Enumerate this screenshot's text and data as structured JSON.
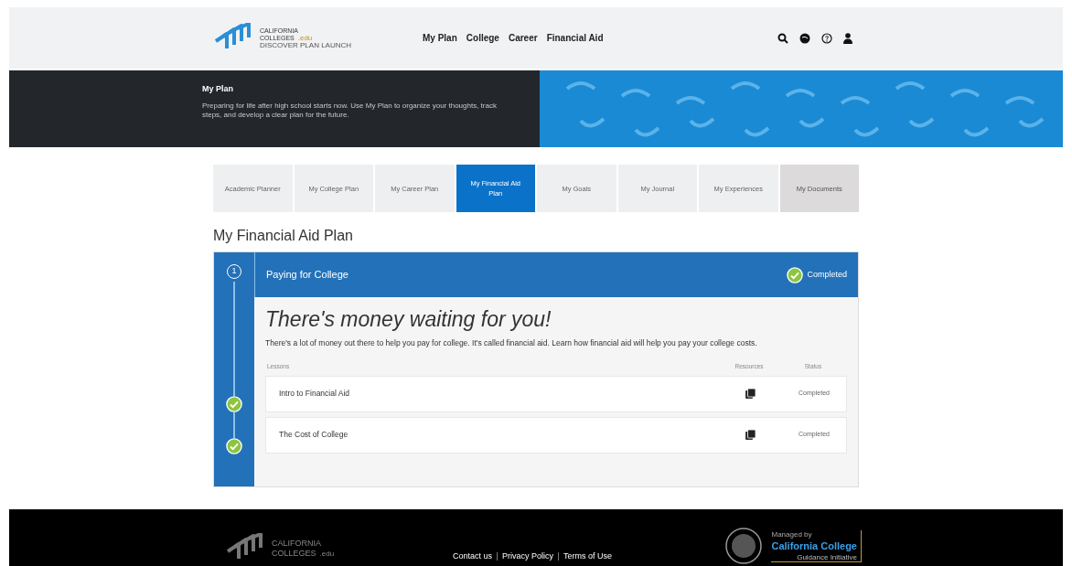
{
  "header": {
    "logo": {
      "line1": "CALIFORNIA",
      "line2": "COLLEGES",
      "suffix": ".edu",
      "tagline": "DISCOVER PLAN LAUNCH"
    },
    "nav": [
      "My Plan",
      "College",
      "Career",
      "Financial Aid"
    ]
  },
  "hero": {
    "title": "My Plan",
    "text": "Preparing for life after high school starts now. Use My Plan to organize your thoughts, track steps, and develop a clear plan for the future."
  },
  "tabs": [
    {
      "label": "Academic Planner",
      "selected": false
    },
    {
      "label": "My College Plan",
      "selected": false
    },
    {
      "label": "My Career Plan",
      "selected": false
    },
    {
      "label": "My Financial Aid Plan",
      "selected": true
    },
    {
      "label": "My Goals",
      "selected": false
    },
    {
      "label": "My Journal",
      "selected": false
    },
    {
      "label": "My Experiences",
      "selected": false
    },
    {
      "label": "My Documents",
      "selected": false
    }
  ],
  "page_title": "My Financial Aid Plan",
  "step": {
    "number": "1",
    "title": "Paying for College",
    "completed": true,
    "status": "Completed",
    "heading": "There's money waiting for you!",
    "text": "There's a lot of money out there to help you pay for college. It's called financial aid. Learn how financial aid will help you pay your college costs.",
    "columns": [
      "Lessons",
      "Resources",
      "Status"
    ],
    "lessons": [
      {
        "title": "Intro to Financial Aid",
        "status": "Completed",
        "completed": true
      },
      {
        "title": "The Cost of College",
        "status": "Completed",
        "completed": true
      }
    ]
  },
  "footer": {
    "logo": {
      "line1": "CALIFORNIA",
      "line2": "COLLEGES",
      "suffix": ".edu"
    },
    "links": [
      "Contact us",
      "Privacy Policy",
      "Terms of Use"
    ],
    "partner": {
      "caption": "Managed by",
      "name": "California College",
      "sub": "Guidance Initiative"
    }
  }
}
